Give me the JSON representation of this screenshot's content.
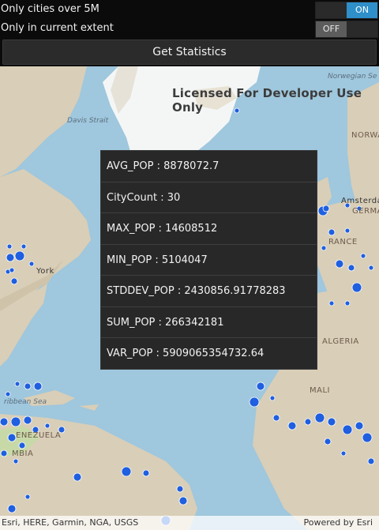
{
  "options": {
    "cities_over_5m": {
      "label": "Only cities over 5M",
      "state": "ON"
    },
    "current_extent": {
      "label": "Only in current extent",
      "state": "OFF"
    }
  },
  "get_stats_button": "Get Statistics",
  "map": {
    "watermark": "Licensed For Developer Use Only",
    "labels": {
      "norwegian_sea": "Norwegian Se",
      "davis_strait": "Davis Strait",
      "caribbean_sea": "ribbean Sea",
      "new_york": "York",
      "norway": "NORWA",
      "amsterdam": "Amsterdar",
      "germany": "GERMA",
      "france": "RANCE",
      "algeria": "ALGERIA",
      "mali": "MALI",
      "venezuela": "ENEZUELA",
      "colombia": "MBIA"
    },
    "colors": {
      "water": "#9fc7dd",
      "land": "#d9ceb7",
      "ice": "#f4f6f6",
      "city": "#1f5fe0"
    }
  },
  "stats": [
    "AVG_POP : 8878072.7",
    "CityCount : 30",
    "MAX_POP : 14608512",
    "MIN_POP : 5104047",
    "STDDEV_POP : 2430856.91778283",
    "SUM_POP : 266342181",
    "VAR_POP : 5909065354732.64"
  ],
  "footer": {
    "attribution": "Esri, HERE, Garmin, NGA, USGS",
    "powered_by": "Powered by Esri"
  }
}
